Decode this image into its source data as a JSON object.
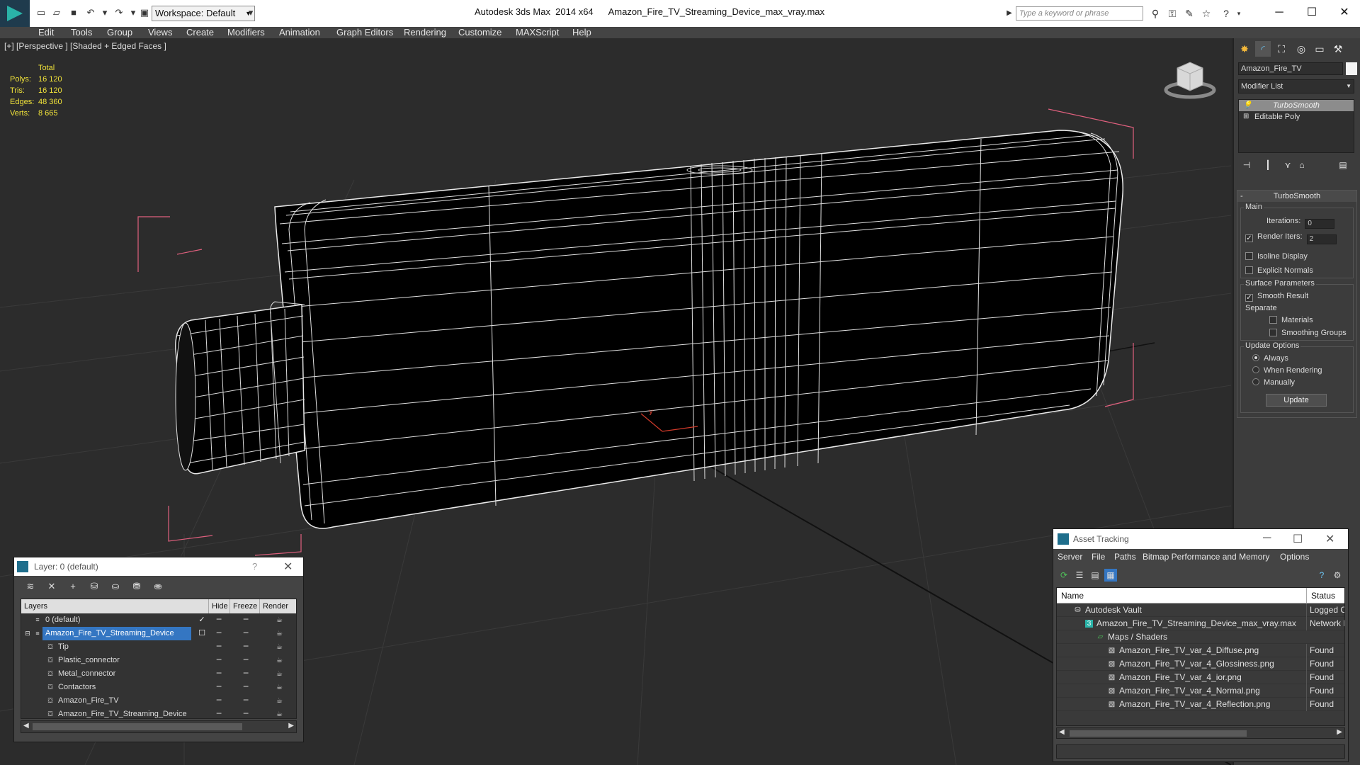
{
  "titlebar": {
    "workspace": "Workspace: Default",
    "app_title": "Autodesk 3ds Max  2014 x64",
    "file_title": "Amazon_Fire_TV_Streaming_Device_max_vray.max",
    "search_placeholder": "Type a keyword or phrase"
  },
  "menu": [
    "Edit",
    "Tools",
    "Group",
    "Views",
    "Create",
    "Modifiers",
    "Animation",
    "Graph Editors",
    "Rendering",
    "Customize",
    "MAXScript",
    "Help"
  ],
  "viewport": {
    "label": "[+] [Perspective ] [Shaded + Edged Faces ]",
    "stats": {
      "header": "Total",
      "rows": [
        {
          "key": "Polys:",
          "value": "16 120"
        },
        {
          "key": "Tris:",
          "value": "16 120"
        },
        {
          "key": "Edges:",
          "value": "48 360"
        },
        {
          "key": "Verts:",
          "value": "8 665"
        }
      ]
    }
  },
  "command_panel": {
    "object_name": "Amazon_Fire_TV",
    "modifier_list": "Modifier List",
    "stack": [
      "TurboSmooth",
      "Editable Poly"
    ],
    "rollout_title": "TurboSmooth",
    "main_group": "Main",
    "iterations_label": "Iterations:",
    "iterations_value": "0",
    "render_iters_label": "Render Iters:",
    "render_iters_value": "2",
    "isoline": "Isoline Display",
    "explicit_normals": "Explicit Normals",
    "surface_group": "Surface Parameters",
    "smooth_result": "Smooth Result",
    "separate": "Separate",
    "materials": "Materials",
    "smoothing_groups": "Smoothing Groups",
    "update_group": "Update Options",
    "always": "Always",
    "when_rendering": "When Rendering",
    "manually": "Manually",
    "update_button": "Update"
  },
  "layer_dialog": {
    "title": "Layer: 0 (default)",
    "help": "?",
    "columns": {
      "layers": "Layers",
      "hide": "Hide",
      "freeze": "Freeze",
      "render": "Render"
    },
    "rows": [
      {
        "name": "0 (default)",
        "level": 0
      },
      {
        "name": "Amazon_Fire_TV_Streaming_Device",
        "level": 0
      },
      {
        "name": "Tip",
        "level": 1
      },
      {
        "name": "Plastic_connector",
        "level": 1
      },
      {
        "name": "Metal_connector",
        "level": 1
      },
      {
        "name": "Contactors",
        "level": 1
      },
      {
        "name": "Amazon_Fire_TV",
        "level": 1
      },
      {
        "name": "Amazon_Fire_TV_Streaming_Device",
        "level": 1
      }
    ]
  },
  "asset_tracking": {
    "title": "Asset Tracking",
    "menu": [
      "Server",
      "File",
      "Paths",
      "Bitmap Performance and Memory",
      "Options"
    ],
    "columns": {
      "name": "Name",
      "status": "Status"
    },
    "rows": [
      {
        "name": "Autodesk Vault",
        "status": "Logged Out",
        "level": 0
      },
      {
        "name": "Amazon_Fire_TV_Streaming_Device_max_vray.max",
        "status": "Network Path",
        "level": 1
      },
      {
        "name": "Maps / Shaders",
        "status": "",
        "level": 2
      },
      {
        "name": "Amazon_Fire_TV_var_4_Diffuse.png",
        "status": "Found",
        "level": 3
      },
      {
        "name": "Amazon_Fire_TV_var_4_Glossiness.png",
        "status": "Found",
        "level": 3
      },
      {
        "name": "Amazon_Fire_TV_var_4_ior.png",
        "status": "Found",
        "level": 3
      },
      {
        "name": "Amazon_Fire_TV_var_4_Normal.png",
        "status": "Found",
        "level": 3
      },
      {
        "name": "Amazon_Fire_TV_var_4_Reflection.png",
        "status": "Found",
        "level": 3
      }
    ]
  },
  "colors": {
    "stats_text": "#f2e43a",
    "selection": "#3476c2",
    "bounding_box": "#e0607e",
    "viewport_bg": "#2c2c2c"
  }
}
